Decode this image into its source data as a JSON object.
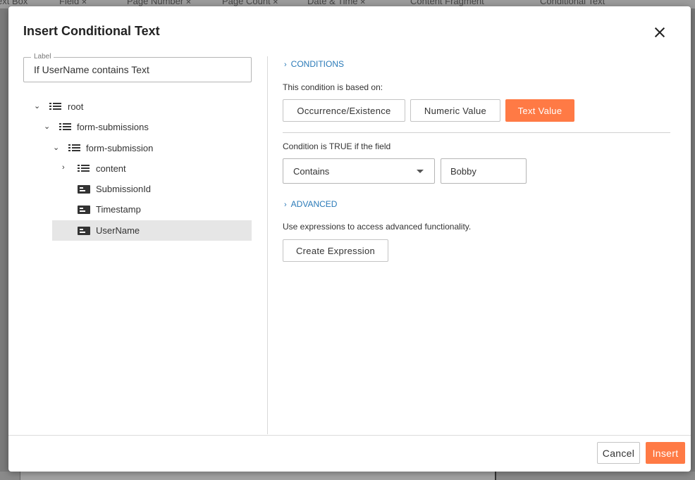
{
  "background": {
    "tabs": [
      {
        "label": "ext Box"
      },
      {
        "label": "Field"
      },
      {
        "label": "Page Number"
      },
      {
        "label": "Page Count"
      },
      {
        "label": "Date & Time"
      },
      {
        "label": "Content Fragment"
      },
      {
        "label": "Conditional Text"
      }
    ]
  },
  "dialog": {
    "title": "Insert Conditional Text",
    "label_field": {
      "legend": "Label",
      "value": "If UserName contains Text"
    },
    "tree": [
      {
        "label": "root",
        "type": "list",
        "expanded": true,
        "depth": 0
      },
      {
        "label": "form-submissions",
        "type": "list",
        "expanded": true,
        "depth": 1
      },
      {
        "label": "form-submission",
        "type": "list",
        "expanded": true,
        "depth": 2
      },
      {
        "label": "content",
        "type": "list",
        "expanded": false,
        "depth": 3
      },
      {
        "label": "SubmissionId",
        "type": "field",
        "depth": 3
      },
      {
        "label": "Timestamp",
        "type": "field",
        "depth": 3
      },
      {
        "label": "UserName",
        "type": "field",
        "depth": 3,
        "selected": true
      }
    ],
    "conditions": {
      "header": "CONDITIONS",
      "based_on_text": "This condition is based on:",
      "types": [
        {
          "label": "Occurrence/Existence",
          "active": false
        },
        {
          "label": "Numeric Value",
          "active": false
        },
        {
          "label": "Text Value",
          "active": true
        }
      ],
      "true_if_text": "Condition is TRUE if the field",
      "operator": "Contains",
      "value": "Bobby"
    },
    "advanced": {
      "header": "ADVANCED",
      "help_text": "Use expressions to access advanced functionality.",
      "create_expression_label": "Create Expression"
    },
    "footer": {
      "cancel_label": "Cancel",
      "insert_label": "Insert"
    },
    "accent_color": "#ff7a45",
    "link_color": "#2a7ab8"
  }
}
